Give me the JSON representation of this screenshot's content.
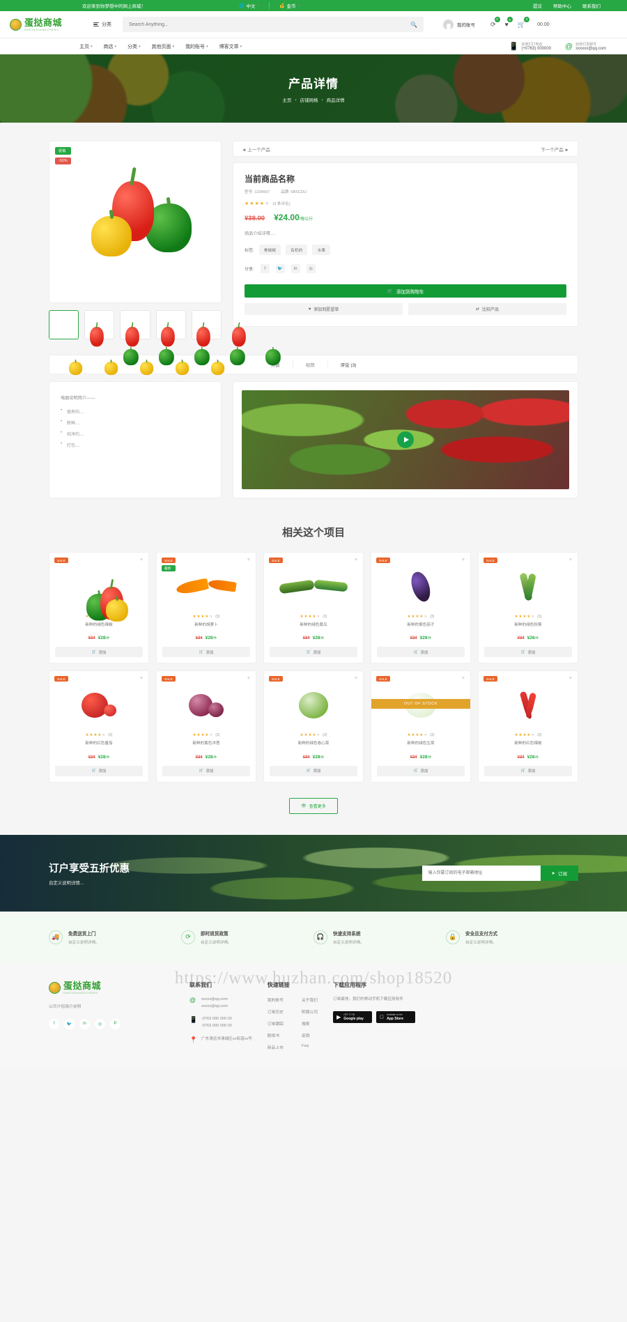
{
  "topbar": {
    "welcome": "欢迎来到你梦想中的网上商城！",
    "language": "中文",
    "currency": "金币",
    "links": [
      "提议",
      "帮助中心",
      "联系我们"
    ]
  },
  "header": {
    "logo_main": "蛋挞商城",
    "logo_sub": "DANTASHANGCHENG",
    "category_label": "分类",
    "search_placeholder": "Search Anything...",
    "search_icon": "search-icon",
    "account_label": "我的账号",
    "compare_count": "0",
    "wishlist_count": "0",
    "cart_count": "0",
    "cart_total": "00.00"
  },
  "nav": {
    "items": [
      "主页",
      "商店",
      "分类",
      "其他页面",
      "我的账号",
      "博客文章"
    ],
    "phone_label": "给我们打电话",
    "phone_value": "(+0763) 000000",
    "email_label": "给我们发邮件",
    "email_value": "xxxxxx@qq.com"
  },
  "hero": {
    "title": "产品详情",
    "breadcrumbs": [
      "主页",
      "店铺网格",
      "商品详情"
    ]
  },
  "product": {
    "badge_sale": "促销",
    "badge_off": "-50%",
    "prev_label": "上一个产品",
    "next_label": "下一个产品",
    "name": "当前商品名称",
    "model_label": "型号:",
    "model_value": "1234567",
    "brand_label": "品牌:",
    "brand_value": "6BSCDU",
    "stars": "★★★★",
    "star_dim": "★",
    "review_count": "(3 条评论)",
    "old_price": "¥38.00",
    "new_price": "¥24.00",
    "unit": "/每公斤",
    "description": "商品介绍详情....",
    "tags_label": "标签:",
    "tags": [
      "青椒椒",
      "有机的",
      "水果"
    ],
    "share_label": "分享:",
    "share_icons": [
      "facebook-icon",
      "twitter-icon",
      "linkedin-icon",
      "instagram-icon"
    ],
    "add_to_cart": "添加到购物车",
    "wishlist_btn": "添加到愿望单",
    "compare_btn": "比较产品"
  },
  "tabs": {
    "items": [
      {
        "label": "关键",
        "active": false
      },
      {
        "label": "视频",
        "active": false
      },
      {
        "label": "评论 (3)",
        "active": true
      }
    ]
  },
  "description": {
    "lead": "电器说明简介——",
    "items": [
      "营养的....",
      "新鲜....",
      "纯净的....",
      "打包...."
    ]
  },
  "video": {
    "play_icon": "play-icon"
  },
  "related": {
    "title": "相关这个项目",
    "load_more": "查看更多",
    "eye_icon": "eye-icon",
    "products": [
      {
        "badge": "SALE",
        "badge2": "",
        "name": "新鲜的绿色辣椒",
        "stars": "★★★★",
        "dim": "★",
        "count": "(3)",
        "old": "¥34",
        "new": "¥28",
        "unit": "/件",
        "btn": "添加",
        "stock": true,
        "kind": "pepper"
      },
      {
        "badge": "SALE",
        "badge2": "最新",
        "name": "新鲜的胡萝卜",
        "stars": "★★★★",
        "dim": "★",
        "count": "(3)",
        "old": "¥34",
        "new": "¥28",
        "unit": "/件",
        "btn": "添加",
        "stock": true,
        "kind": "carrot"
      },
      {
        "badge": "SALE",
        "badge2": "",
        "name": "新鲜的绿色黄瓜",
        "stars": "★★★★",
        "dim": "★",
        "count": "(3)",
        "old": "¥34",
        "new": "¥28",
        "unit": "/件",
        "btn": "添加",
        "stock": true,
        "kind": "cucumber"
      },
      {
        "badge": "SALE",
        "badge2": "",
        "name": "新鲜的紫色茄子",
        "stars": "★★★★",
        "dim": "★",
        "count": "(3)",
        "old": "¥34",
        "new": "¥28",
        "unit": "/件",
        "btn": "添加",
        "stock": true,
        "kind": "eggplant"
      },
      {
        "badge": "SALE",
        "badge2": "",
        "name": "新鲜的绿色秋葵",
        "stars": "★★★★",
        "dim": "★",
        "count": "(3)",
        "old": "¥34",
        "new": "¥28",
        "unit": "/件",
        "btn": "添加",
        "stock": true,
        "kind": "okra"
      },
      {
        "badge": "SALE",
        "badge2": "",
        "name": "新鲜的红色番茄",
        "stars": "★★★★",
        "dim": "★",
        "count": "(3)",
        "old": "¥34",
        "new": "¥28",
        "unit": "/件",
        "btn": "添加",
        "stock": true,
        "kind": "tomato"
      },
      {
        "badge": "SALE",
        "badge2": "",
        "name": "新鲜的紫色洋葱",
        "stars": "★★★★",
        "dim": "★",
        "count": "(3)",
        "old": "¥34",
        "new": "¥28",
        "unit": "/件",
        "btn": "添加",
        "stock": true,
        "kind": "onion"
      },
      {
        "badge": "SALE",
        "badge2": "",
        "name": "新鲜的绿色卷心菜",
        "stars": "★★★★",
        "dim": "★",
        "count": "(3)",
        "old": "¥34",
        "new": "¥28",
        "unit": "/件",
        "btn": "添加",
        "stock": true,
        "kind": "cabbage"
      },
      {
        "badge": "SALE",
        "badge2": "",
        "name": "新鲜的绿色生菜",
        "stars": "★★★★",
        "dim": "★",
        "count": "(3)",
        "old": "¥34",
        "new": "¥28",
        "unit": "/件",
        "btn": "添加",
        "stock": false,
        "out_of_stock": "OUT OF STOCK",
        "kind": "lettuce"
      },
      {
        "badge": "SALE",
        "badge2": "",
        "name": "新鲜的红色辣椒",
        "stars": "★★★★",
        "dim": "★",
        "count": "(3)",
        "old": "¥34",
        "new": "¥28",
        "unit": "/件",
        "btn": "添加",
        "stock": true,
        "kind": "chili"
      }
    ]
  },
  "newsletter": {
    "heading": "订户享受五折优惠",
    "sub": "自定义说明详情...",
    "placeholder": "输入你要订阅的电子邮箱地址",
    "button": "订阅",
    "button_icon": "paper-plane-icon"
  },
  "features": [
    {
      "icon": "truck-icon",
      "title": "免费送货上门",
      "sub": "自定义说明详情。"
    },
    {
      "icon": "refresh-icon",
      "title": "即时退货政策",
      "sub": "自定义说明详情。"
    },
    {
      "icon": "headset-icon",
      "title": "快速支持系统",
      "sub": "自定义说明详情。"
    },
    {
      "icon": "lock-icon",
      "title": "安全且支付方式",
      "sub": "自定义说明详情。"
    }
  ],
  "footer": {
    "logo_main": "蛋挞商城",
    "logo_sub": "DANTASHANGCHENG",
    "about": "公司介绍简介说明",
    "socials": [
      "facebook-icon",
      "twitter-icon",
      "linkedin-icon",
      "instagram-icon",
      "pinterest-icon"
    ],
    "contact_head": "联系我们",
    "emails": [
      "xxxxx@qq.com",
      "xxxxx@qq.com"
    ],
    "phones": [
      "-0763 000 000 00",
      "-0763 000 000 00"
    ],
    "address": "广东清远市清城区xx街道xx号",
    "links_head": "快速链接",
    "links_col1": [
      "我的账号",
      "订单历史",
      "订单跟踪",
      "联络书",
      "新品上市"
    ],
    "links_col2": [
      "关于我们",
      "附属公司",
      "搜索",
      "促销",
      "Faq"
    ],
    "app_head": "下载应用程序",
    "app_sub": "订单最快，我们的移动手机下载应用软件",
    "store1_t1": "GET IT ON",
    "store1_t2": "Google play",
    "store2_t1": "Available on the",
    "store2_t2": "App Store"
  },
  "watermark": "https://www.huzhan.com/shop18520"
}
